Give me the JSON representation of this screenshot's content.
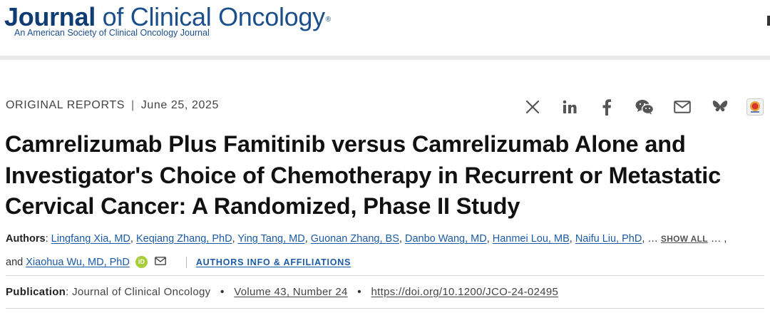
{
  "header": {
    "journal_word1": "Journal",
    "journal_rest": "of Clinical Oncology",
    "registered": "®",
    "subtitle": "An American Society of Clinical Oncology Journal"
  },
  "article_meta": {
    "category": "ORIGINAL REPORTS",
    "separator": "|",
    "date": "June 25, 2025"
  },
  "share_icons": [
    "x-icon",
    "linkedin-icon",
    "facebook-icon",
    "wechat-icon",
    "email-icon",
    "bluesky-icon",
    "mendeley-icon"
  ],
  "title": "Camrelizumab Plus Famitinib versus Camrelizumab Alone and Investigator's Choice of Chemotherapy in Recurrent or Metastatic Cervical Cancer: A Randomized, Phase II Study",
  "authors": {
    "label": "Authors",
    "colon": ":",
    "list": [
      "Lingfang Xia, MD",
      "Keqiang Zhang, PhD",
      "Ying Tang, MD",
      "Guonan Zhang, BS",
      "Danbo Wang, MD",
      "Hanmei Lou, MB",
      "Naifu Liu, PhD"
    ],
    "ellipsis": "…",
    "show_all": "SHOW ALL",
    "trailing": "… ,",
    "and_text": "and",
    "last_author": "Xiaohua Wu, MD, PhD",
    "orcid_text": "iD",
    "affiliations_link": "AUTHORS INFO & AFFILIATIONS"
  },
  "publication": {
    "label": "Publication",
    "colon": ":",
    "journal": "Journal of Clinical Oncology",
    "bullet": "•",
    "volume": "Volume 43, Number 24",
    "doi": "https://doi.org/10.1200/JCO-24-02495"
  },
  "colors": {
    "journal_blue": "#1b4f8c",
    "link_blue": "#1a5aa6",
    "orcid_green": "#a6ce39"
  }
}
